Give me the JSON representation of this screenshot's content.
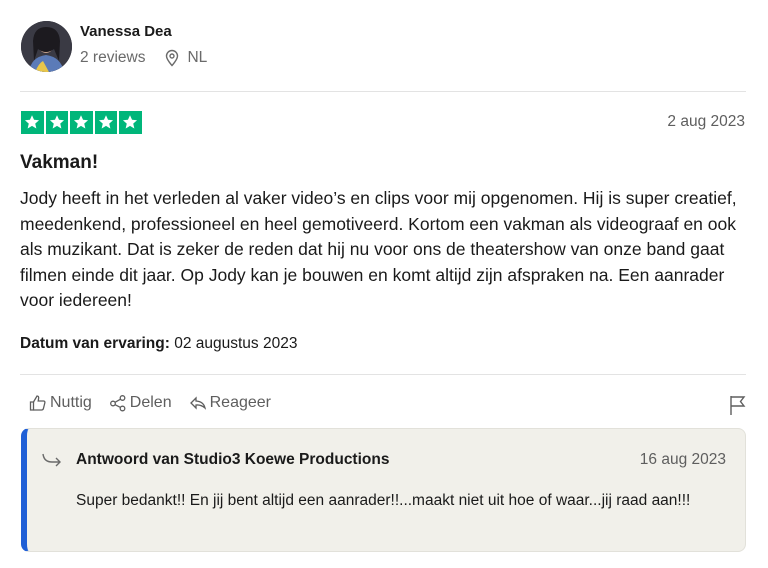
{
  "reviewer": {
    "name": "Vanessa Dea",
    "reviews": "2 reviews",
    "country": "NL"
  },
  "review": {
    "rating": 5,
    "rating_color": "#00b67a",
    "date": "2 aug 2023",
    "title": "Vakman!",
    "body": "Jody heeft in het verleden al vaker video’s en clips voor mij opgenomen. Hij is super creatief, meedenkend, professioneel en heel gemotiveerd. Kortom een vakman als videograaf en ook als muzikant. Dat is zeker de reden dat hij nu voor ons de theatershow van onze band gaat filmen einde dit jaar. Op Jody kan je bouwen en komt altijd zijn afspraken na. Een aanrader voor iedereen!",
    "experience_label": "Datum van ervaring:",
    "experience_date": "02 augustus 2023"
  },
  "actions": {
    "useful": "Nuttig",
    "share": "Delen",
    "reply": "Reageer",
    "flag_icon": "flag-icon"
  },
  "reply": {
    "title": "Antwoord van Studio3 Koewe Productions",
    "date": "16 aug 2023",
    "body": "Super bedankt!! En jij bent altijd een aanrader!!...maakt niet uit hoe of waar...jij raad aan!!!",
    "accent_color": "#1f5fd6"
  }
}
